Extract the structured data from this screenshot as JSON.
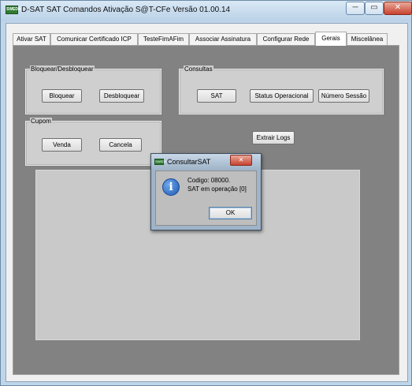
{
  "window": {
    "title": "D-SAT SAT Comandos Ativação S@T-CFe Versão 01.00.14",
    "app_icon_text": "SWEDA",
    "minimize_symbol": "─",
    "maximize_symbol": "▭",
    "close_symbol": "✕"
  },
  "tabs": [
    {
      "label": "Ativar SAT"
    },
    {
      "label": "Comunicar Certificado ICP"
    },
    {
      "label": "TesteFimAFim"
    },
    {
      "label": "Associar Assinatura"
    },
    {
      "label": "Configurar Rede"
    },
    {
      "label": "Gerais"
    },
    {
      "label": "Miscelânea"
    }
  ],
  "active_tab": "Gerais",
  "groups": {
    "bloquear": {
      "title": "Bloquear/Desbloquear",
      "buttons": [
        "Bloquear",
        "Desbloquear"
      ]
    },
    "consultas": {
      "title": "Consultas",
      "buttons": [
        "SAT",
        "Status Operacional",
        "Número Sessão"
      ]
    },
    "cupom": {
      "title": "Cupom",
      "buttons": [
        "Venda",
        "Cancela"
      ]
    }
  },
  "extrair_logs": "Extrair Logs",
  "dialog": {
    "title": "ConsultarSAT",
    "icon_text": "SWEDA",
    "close_symbol": "✕",
    "info_symbol": "i",
    "line1": "Codigo: 08000.",
    "line2": "SAT em operação [0]",
    "ok_label": "OK"
  }
}
